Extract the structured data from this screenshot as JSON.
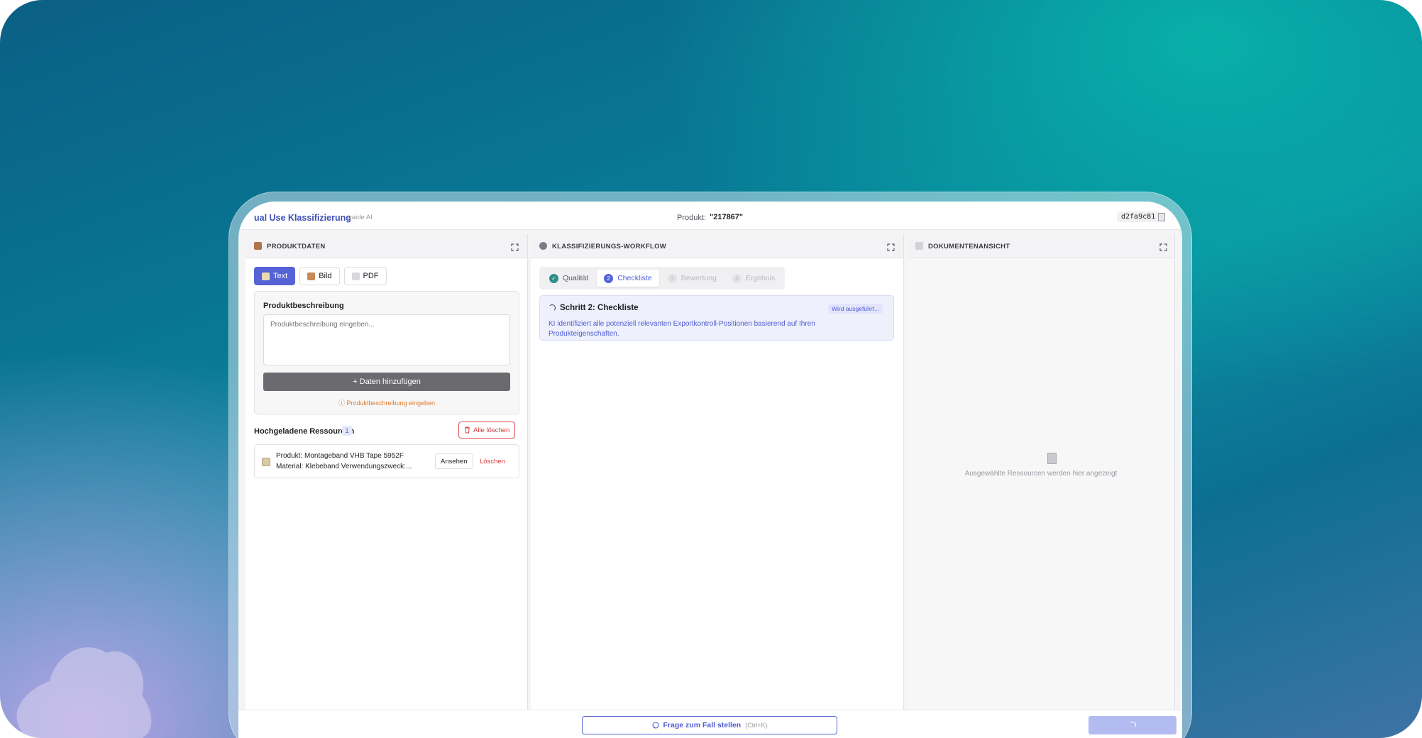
{
  "app": {
    "title": "ual Use Klassifizierung",
    "subtitle": "traide AI"
  },
  "header": {
    "product_label": "Produkt:",
    "product_value": "\"217867\"",
    "session_id": "d2fa9c81"
  },
  "panels": {
    "product": {
      "title": "PRODUKTDATEN",
      "tabs": [
        {
          "label": "Text",
          "icon": "text-icon",
          "active": true
        },
        {
          "label": "Bild",
          "icon": "image-icon",
          "active": false
        },
        {
          "label": "PDF",
          "icon": "pdf-icon",
          "active": false
        }
      ],
      "description": {
        "label": "Produktbeschreibung",
        "placeholder": "Produktbeschreibung eingeben...",
        "value": "",
        "add_button": "+ Daten hinzufügen",
        "hint": "ⓘ Produktbeschreibung eingeben"
      },
      "resources": {
        "title": "Hochgeladene Ressourcen",
        "count": "1",
        "clear_all": "Alle löschen",
        "items": [
          {
            "line1": "Produkt: Montageband VHB Tape 5952F",
            "line2": "Material: Klebeband Verwendungszweck:...",
            "view": "Ansehen",
            "delete": "Löschen"
          }
        ]
      }
    },
    "workflow": {
      "title": "KLASSIFIZIERUNGS-WORKFLOW",
      "steps": [
        {
          "label": "Qualität",
          "marker": "✓",
          "state": "done"
        },
        {
          "label": "Checkliste",
          "marker": "2",
          "state": "active"
        },
        {
          "label": "Bewertung",
          "marker": "3",
          "state": "pending"
        },
        {
          "label": "Ergebnis",
          "marker": "4",
          "state": "pending"
        }
      ],
      "current": {
        "title": "Schritt 2: Checkliste",
        "status": "Wird ausgeführt...",
        "description": "KI identifiziert alle potenziell relevanten Exportkontroll-Positionen basierend auf Ihren Produkteigenschaften."
      }
    },
    "documents": {
      "title": "DOKUMENTENANSICHT",
      "empty_text": "Ausgewählte Ressourcen werden hier angezeigt"
    }
  },
  "footer": {
    "ask_label": "Frage zum Fall stellen",
    "ask_shortcut": "(Ctrl+K)"
  },
  "colors": {
    "accent": "#5563d6",
    "danger": "#d43b3b",
    "warning": "#e07a2c",
    "success": "#2f8f8a"
  }
}
